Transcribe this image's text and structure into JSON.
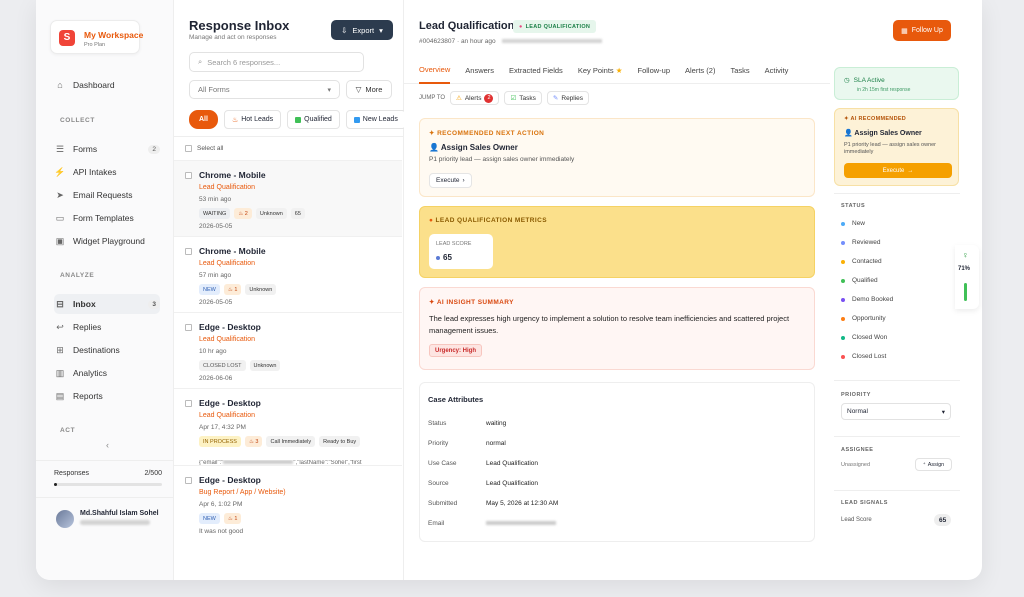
{
  "sidebar": {
    "workspace_name": "My Workspace",
    "workspace_plan": "Pro Plan",
    "logo_letter": "S",
    "dashboard": "Dashboard",
    "sections": {
      "collect": "COLLECT",
      "analyze": "ANALYZE",
      "act": "ACT"
    },
    "collect_items": [
      {
        "label": "Forms",
        "count": "2"
      },
      {
        "label": "API Intakes",
        "count": ""
      },
      {
        "label": "Email Requests",
        "count": ""
      },
      {
        "label": "Form Templates",
        "count": ""
      },
      {
        "label": "Widget Playground",
        "count": ""
      }
    ],
    "analyze_items": [
      {
        "label": "Inbox",
        "count": "3"
      },
      {
        "label": "Replies",
        "count": ""
      },
      {
        "label": "Destinations",
        "count": ""
      },
      {
        "label": "Analytics",
        "count": ""
      },
      {
        "label": "Reports",
        "count": ""
      }
    ],
    "collapse_glyph": "‹",
    "quota": {
      "label": "Responses",
      "value": "2/500",
      "fraction": 0.004
    },
    "user_name": "Md.Shahful Islam Sohel"
  },
  "inbox": {
    "title": "Response Inbox",
    "subtitle": "Manage and act on responses",
    "export_label": "Export",
    "search_placeholder": "Search 6 responses...",
    "filter_select": "All Forms",
    "more_label": "More",
    "chips": [
      "All",
      "Hot Leads",
      "Qualified",
      "New Leads"
    ],
    "select_all": "Select all",
    "items": [
      {
        "title": "Chrome - Mobile",
        "tag": "Lead Qualification",
        "time": "53 min ago",
        "badges": [
          "WAITING",
          "2",
          "Unknown",
          "65"
        ],
        "date": "2026-05-05"
      },
      {
        "title": "Chrome - Mobile",
        "tag": "Lead Qualification",
        "time": "57 min ago",
        "badges": [
          "NEW",
          "1",
          "Unknown"
        ],
        "date": "2026-05-05"
      },
      {
        "title": "Edge - Desktop",
        "tag": "Lead Qualification",
        "time": "10 hr ago",
        "badges": [
          "CLOSED LOST",
          "Unknown"
        ],
        "date": "2026-06-06"
      },
      {
        "title": "Edge - Desktop",
        "tag": "Lead Qualification",
        "time": "Apr 17, 4:32 PM",
        "badges": [
          "IN PROCESS",
          "3",
          "Call Immediately",
          "Ready to Buy"
        ],
        "json_start": "{\"email\":\"",
        "json_end": "\",\"lastName\":\"Sohel\",\"first"
      },
      {
        "title": "Edge - Desktop",
        "tag": "Bug Report / App / Website)",
        "time": "Apr 6, 1:02 PM",
        "badges": [
          "NEW",
          "1"
        ],
        "note": "It was not good"
      }
    ]
  },
  "detail": {
    "title": "Lead Qualification",
    "tag": "LEAD QUALIFICATION",
    "id": "#004623807",
    "time": "an hour ago",
    "tabs": [
      "Overview",
      "Answers",
      "Extracted Fields",
      "Key Points",
      "Follow-up",
      "Alerts (2)",
      "Tasks",
      "Activity"
    ],
    "jump_to": "JUMP TO",
    "jump_chips": [
      "Alerts",
      "Tasks",
      "Replies"
    ],
    "jump_alert_count": "2",
    "next_action": {
      "heading": "RECOMMENDED NEXT ACTION",
      "action": "Assign Sales Owner",
      "desc": "P1 priority lead — assign sales owner immediately",
      "button": "Execute"
    },
    "metrics": {
      "heading": "LEAD QUALIFICATION METRICS",
      "label": "LEAD SCORE",
      "value": "65"
    },
    "insight": {
      "heading": "AI INSIGHT SUMMARY",
      "text": "The lead expresses high urgency to implement a solution to resolve team inefficiencies and scattered project management issues.",
      "urgency": "Urgency: High"
    },
    "attributes": {
      "heading": "Case Attributes",
      "rows": [
        {
          "k": "Status",
          "v": "waiting"
        },
        {
          "k": "Priority",
          "v": "normal"
        },
        {
          "k": "Use Case",
          "v": "Lead Qualification"
        },
        {
          "k": "Source",
          "v": "Lead Qualification"
        },
        {
          "k": "Submitted",
          "v": "May 5, 2026 at 12:30 AM"
        },
        {
          "k": "Email",
          "v": ""
        }
      ]
    }
  },
  "right": {
    "follow_up": "Follow Up",
    "sla_title": "SLA Active",
    "sla_sub": "in 2h 15m first response",
    "ai_rec": {
      "heading": "AI RECOMMENDED",
      "action": "Assign Sales Owner",
      "desc": "P1 priority lead — assign sales owner immediately",
      "button": "Execute"
    },
    "status_heading": "STATUS",
    "statuses": [
      {
        "label": "New",
        "color": "#4dabf7"
      },
      {
        "label": "Reviewed",
        "color": "#748ffc"
      },
      {
        "label": "Contacted",
        "color": "#fab005"
      },
      {
        "label": "Qualified",
        "color": "#40c057"
      },
      {
        "label": "Demo Booked",
        "color": "#7950f2"
      },
      {
        "label": "Opportunity",
        "color": "#fd7e14"
      },
      {
        "label": "Closed Won",
        "color": "#12b886"
      },
      {
        "label": "Closed Lost",
        "color": "#fa5252"
      }
    ],
    "priority_heading": "PRIORITY",
    "priority_value": "Normal",
    "assignee_heading": "ASSIGNEE",
    "assignee_value": "Unassigned",
    "assign_button": "Assign",
    "signals_heading": "LEAD SIGNALS",
    "signal_label": "Lead Score",
    "signal_value": "65"
  },
  "widget": {
    "percent": "71%"
  },
  "colors": {
    "accent": "#e8590c",
    "dark": "#2c3b4e"
  }
}
